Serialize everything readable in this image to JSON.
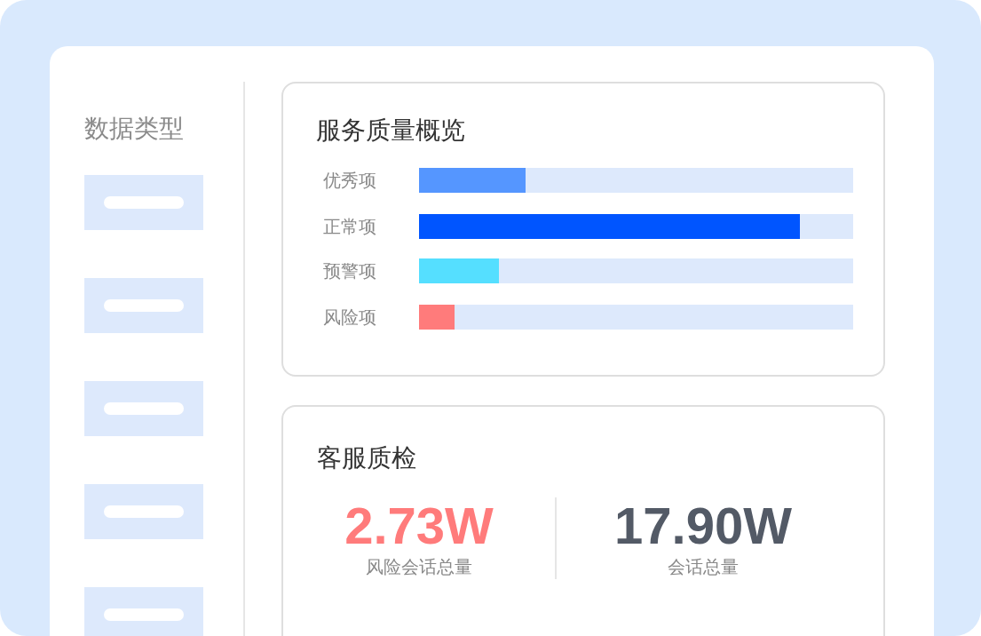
{
  "sidebar": {
    "title": "数据类型"
  },
  "quality_overview": {
    "title": "服务质量概览",
    "items": [
      {
        "label": "优秀项",
        "level": 0.245,
        "color": "#5596ff"
      },
      {
        "label": "正常项",
        "level": 0.878,
        "color": "#0055ff"
      },
      {
        "label": "预警项",
        "level": 0.184,
        "color": "#55dfff"
      },
      {
        "label": "风险项",
        "level": 0.082,
        "color": "#ff7b7b"
      }
    ]
  },
  "inspection": {
    "title": "客服质检",
    "stats": [
      {
        "value": "2.73W",
        "label": "风险会话总量",
        "kind": "risk"
      },
      {
        "value": "17.90W",
        "label": "会话总量",
        "kind": "total"
      }
    ]
  }
}
